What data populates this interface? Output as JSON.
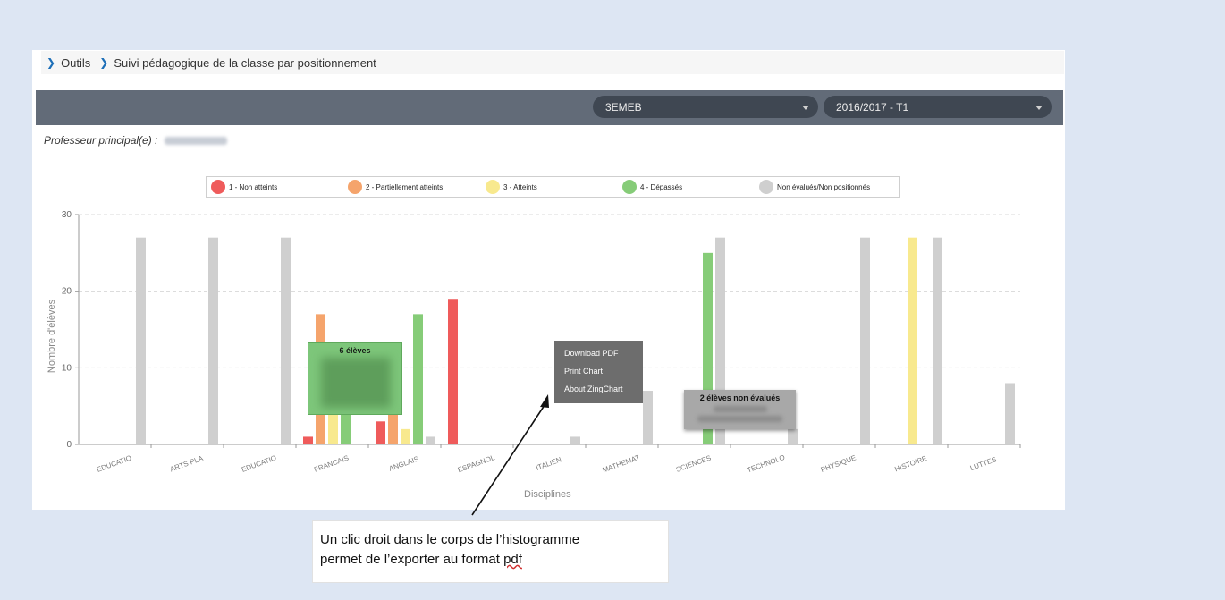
{
  "breadcrumb": {
    "items": [
      "Outils",
      "Suivi pédagogique de la classe par positionnement"
    ]
  },
  "toolbar": {
    "class_select": "3EMEB",
    "period_select": "2016/2017 - T1"
  },
  "professor": {
    "label": "Professeur principal(e) :"
  },
  "legend": [
    {
      "label": "1 - Non atteints",
      "color": "#ef5b5b"
    },
    {
      "label": "2 - Partiellement atteints",
      "color": "#f5a46c"
    },
    {
      "label": "3 - Atteints",
      "color": "#f8e98e"
    },
    {
      "label": "4 - Dépassés",
      "color": "#86cc78"
    },
    {
      "label": "Non évalués/Non positionnés",
      "color": "#cfcfcf"
    }
  ],
  "chart_data": {
    "type": "bar",
    "xlabel": "Disciplines",
    "ylabel": "Nombre d'élèves",
    "ylim": [
      0,
      30
    ],
    "yticks": [
      0,
      10,
      20,
      30
    ],
    "categories": [
      "EDUCATIO",
      "ARTS PLA",
      "EDUCATIO",
      "FRANCAIS",
      "ANGLAIS",
      "ESPAGNOL",
      "ITALIEN",
      "MATHEMAT",
      "SCIENCES",
      "TECHNOLO",
      "PHYSIQUE",
      "HISTOIRE",
      "LUTTES"
    ],
    "series": [
      {
        "name": "1 - Non atteints",
        "values": [
          0,
          0,
          0,
          1,
          3,
          19,
          0,
          0,
          0,
          0,
          0,
          0,
          0
        ]
      },
      {
        "name": "2 - Partiellement atteints",
        "values": [
          0,
          0,
          0,
          17,
          8,
          0,
          0,
          0,
          0,
          0,
          0,
          0,
          0
        ]
      },
      {
        "name": "3 - Atteints",
        "values": [
          0,
          0,
          0,
          6,
          2,
          0,
          0,
          0,
          0,
          0,
          0,
          27,
          0
        ]
      },
      {
        "name": "4 - Dépassés",
        "values": [
          0,
          0,
          0,
          6,
          17,
          0,
          0,
          0,
          25,
          0,
          0,
          0,
          0
        ]
      },
      {
        "name": "Non évalués/Non positionnés",
        "values": [
          27,
          27,
          27,
          0,
          1,
          0,
          1,
          7,
          27,
          2,
          27,
          27,
          8
        ]
      }
    ],
    "grid": true,
    "legend_position": "top"
  },
  "context_menu": {
    "items": [
      "Download PDF",
      "Print Chart",
      "About ZingChart"
    ]
  },
  "tooltips": {
    "green": "6 élèves",
    "gray": "2 élèves non évalués"
  },
  "callout": {
    "line1": "Un clic droit dans le corps de l’histogramme",
    "line2_start": "permet de l’exporter au format ",
    "line2_pdf": "pdf"
  }
}
